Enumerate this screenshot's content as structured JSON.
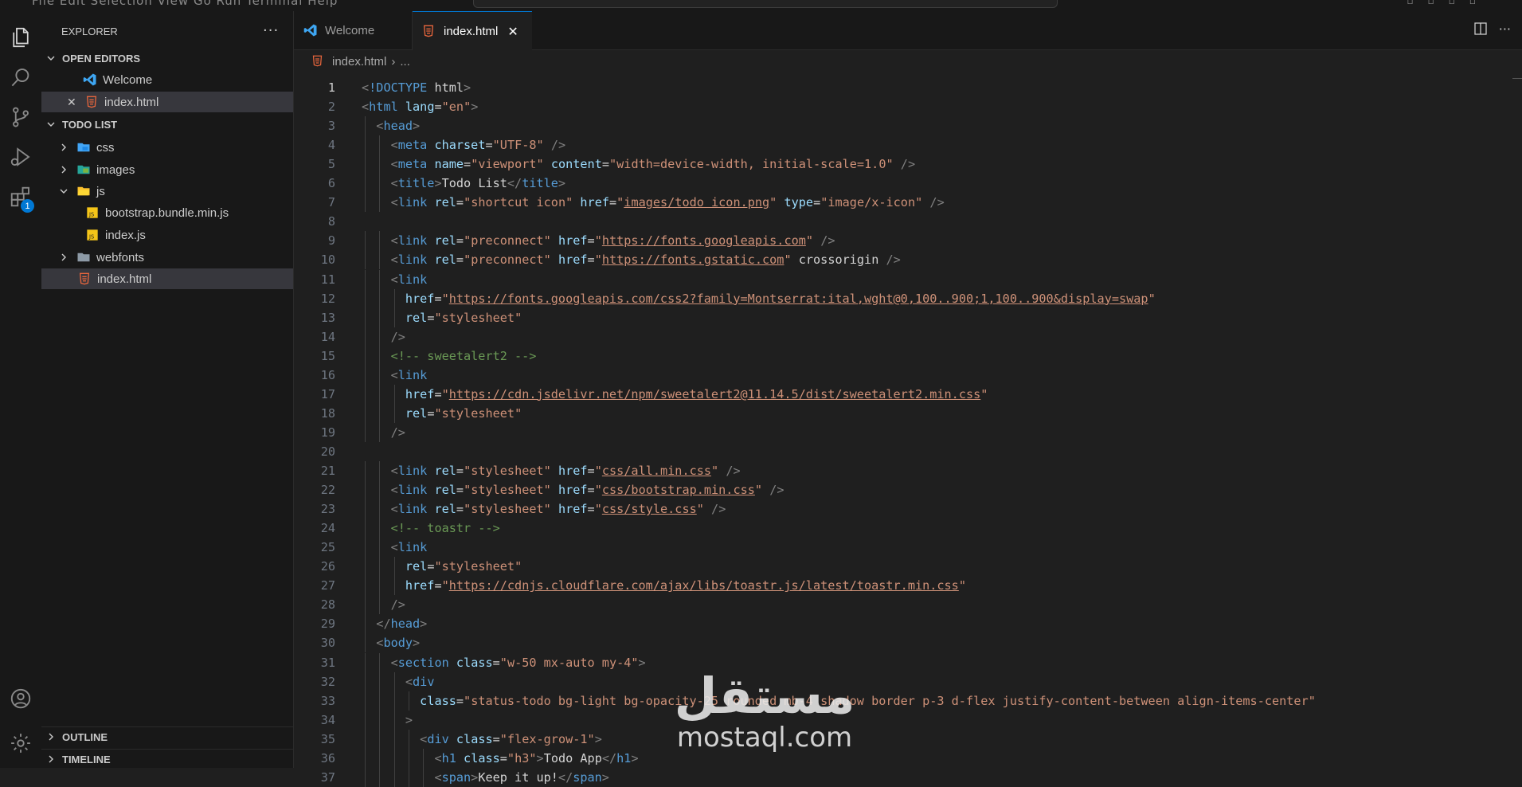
{
  "topbar": {
    "menu_text": "File  Edit  Selection  View  Go  Run  Terminal  Help"
  },
  "activitybar": {
    "items": [
      "explorer-icon",
      "search-icon",
      "source-control-icon",
      "run-debug-icon",
      "extensions-icon"
    ],
    "extensions_badge": "1",
    "bottom": [
      "account-icon",
      "settings-gear-icon"
    ]
  },
  "sidebar": {
    "title": "EXPLORER",
    "more": "···",
    "open_editors": {
      "header": "OPEN EDITORS",
      "items": [
        {
          "label": "Welcome",
          "icon": "vscode-icon"
        },
        {
          "label": "index.html",
          "icon": "html-icon",
          "selected": true
        }
      ]
    },
    "project": {
      "header": "TODO LIST",
      "items": [
        {
          "label": "css",
          "icon": "css-folder-icon",
          "expanded": false
        },
        {
          "label": "images",
          "icon": "images-folder-icon",
          "expanded": false
        },
        {
          "label": "js",
          "icon": "js-folder-icon",
          "expanded": true
        },
        {
          "label": "bootstrap.bundle.min.js",
          "icon": "js-file-icon"
        },
        {
          "label": "index.js",
          "icon": "js-file-icon"
        },
        {
          "label": "webfonts",
          "icon": "folder-icon",
          "expanded": false
        },
        {
          "label": "index.html",
          "icon": "html-icon",
          "selected": true
        }
      ]
    },
    "outline": "OUTLINE",
    "timeline": "TIMELINE"
  },
  "tabs": [
    {
      "label": "Welcome",
      "icon": "vscode-icon",
      "active": false
    },
    {
      "label": "index.html",
      "icon": "html-icon",
      "active": true
    }
  ],
  "tab_close": "✕",
  "breadcrumb": {
    "file": "index.html",
    "rest": "..."
  },
  "editor": {
    "current_line": 1,
    "lines": [
      {
        "n": 1,
        "text": "<!DOCTYPE html>"
      },
      {
        "n": 2,
        "text": "<html lang=\"en\">"
      },
      {
        "n": 3,
        "text": "  <head>"
      },
      {
        "n": 4,
        "text": "    <meta charset=\"UTF-8\" />"
      },
      {
        "n": 5,
        "text": "    <meta name=\"viewport\" content=\"width=device-width, initial-scale=1.0\" />"
      },
      {
        "n": 6,
        "text": "    <title>Todo List</title>"
      },
      {
        "n": 7,
        "text": "    <link rel=\"shortcut icon\" href=\"images/todo icon.png\" type=\"image/x-icon\" />"
      },
      {
        "n": 8,
        "text": ""
      },
      {
        "n": 9,
        "text": "    <link rel=\"preconnect\" href=\"https://fonts.googleapis.com\" />"
      },
      {
        "n": 10,
        "text": "    <link rel=\"preconnect\" href=\"https://fonts.gstatic.com\" crossorigin />"
      },
      {
        "n": 11,
        "text": "    <link"
      },
      {
        "n": 12,
        "text": "      href=\"https://fonts.googleapis.com/css2?family=Montserrat:ital,wght@0,100..900;1,100..900&display=swap\""
      },
      {
        "n": 13,
        "text": "      rel=\"stylesheet\""
      },
      {
        "n": 14,
        "text": "    />"
      },
      {
        "n": 15,
        "text": "    <!-- sweetalert2 -->"
      },
      {
        "n": 16,
        "text": "    <link"
      },
      {
        "n": 17,
        "text": "      href=\"https://cdn.jsdelivr.net/npm/sweetalert2@11.14.5/dist/sweetalert2.min.css\""
      },
      {
        "n": 18,
        "text": "      rel=\"stylesheet\""
      },
      {
        "n": 19,
        "text": "    />"
      },
      {
        "n": 20,
        "text": ""
      },
      {
        "n": 21,
        "text": "    <link rel=\"stylesheet\" href=\"css/all.min.css\" />"
      },
      {
        "n": 22,
        "text": "    <link rel=\"stylesheet\" href=\"css/bootstrap.min.css\" />"
      },
      {
        "n": 23,
        "text": "    <link rel=\"stylesheet\" href=\"css/style.css\" />"
      },
      {
        "n": 24,
        "text": "    <!-- toastr -->"
      },
      {
        "n": 25,
        "text": "    <link"
      },
      {
        "n": 26,
        "text": "      rel=\"stylesheet\""
      },
      {
        "n": 27,
        "text": "      href=\"https://cdnjs.cloudflare.com/ajax/libs/toastr.js/latest/toastr.min.css\""
      },
      {
        "n": 28,
        "text": "    />"
      },
      {
        "n": 29,
        "text": "  </head>"
      },
      {
        "n": 30,
        "text": "  <body>"
      },
      {
        "n": 31,
        "text": "    <section class=\"w-50 mx-auto my-4\">"
      },
      {
        "n": 32,
        "text": "      <div"
      },
      {
        "n": 33,
        "text": "        class=\"status-todo bg-light bg-opacity-25 rounded mb-4 shadow border p-3 d-flex justify-content-between align-items-center\""
      },
      {
        "n": 34,
        "text": "      >"
      },
      {
        "n": 35,
        "text": "        <div class=\"flex-grow-1\">"
      },
      {
        "n": 36,
        "text": "          <h1 class=\"h3\">Todo App</h1>"
      },
      {
        "n": 37,
        "text": "          <span>Keep it up!</span>"
      }
    ]
  },
  "watermark": {
    "arabic": "مستقل",
    "latin": "mostaql.com"
  },
  "colors": {
    "accent": "#0078d4",
    "tag": "#569cd6",
    "attr": "#9cdcfe",
    "string": "#ce9178",
    "comment": "#6a9955"
  }
}
